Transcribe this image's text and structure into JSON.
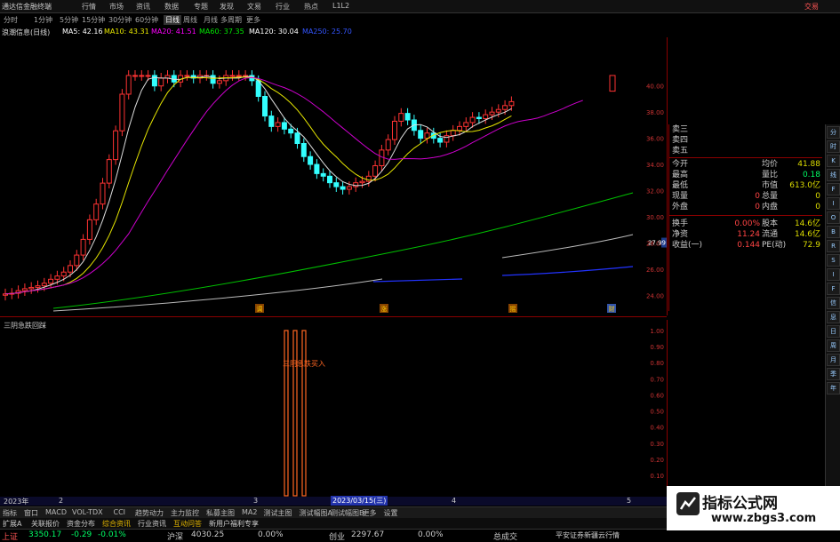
{
  "app": {
    "title": "通达信金融终端",
    "trade": "交易"
  },
  "menu": [
    "行情",
    "市场",
    "资讯",
    "数据",
    "专题",
    "发现",
    "文易",
    "行业",
    "热点",
    "L1L2"
  ],
  "periods": [
    "分时",
    "1分钟",
    "5分钟",
    "15分钟",
    "30分钟",
    "60分钟",
    "日线",
    "周线",
    "月线",
    "多周期",
    "更多"
  ],
  "active_period": "日线",
  "stock_label": "浪潮信息(日线)",
  "ma": [
    {
      "label": "MA5: 42.16",
      "color": "#ffffff"
    },
    {
      "label": "MA10: 43.31",
      "color": "#e6e600"
    },
    {
      "label": "MA20: 41.51",
      "color": "#ff00ff"
    },
    {
      "label": "MA60: 37.35",
      "color": "#00e600"
    },
    {
      "label": "MA120: 30.04",
      "color": "#ffffff"
    },
    {
      "label": "MA250: 25.70",
      "color": "#3355ff"
    }
  ],
  "y_labels": [
    "40.00",
    "38.00",
    "36.00",
    "34.00",
    "32.00",
    "30.00",
    "28.00",
    "26.00",
    "24.00"
  ],
  "price_tag": "27.99",
  "sub_indicator": "三阴急跌回踩",
  "sub_signal_text": "三阴急跌买入",
  "sub_y_labels": [
    "1.00",
    "0.90",
    "0.80",
    "0.70",
    "0.60",
    "0.50",
    "0.40",
    "0.30",
    "0.20",
    "0.10"
  ],
  "markers": [
    "调",
    "涨",
    "摇",
    "财"
  ],
  "quote": {
    "ask_rows": [
      "卖三",
      "卖四",
      "卖五"
    ],
    "rows": [
      {
        "l": "今开",
        "lv": "",
        "r": "均价",
        "rv": "41.88"
      },
      {
        "l": "最高",
        "lv": "",
        "r": "量比",
        "rv": "0.18"
      },
      {
        "l": "最低",
        "lv": "",
        "r": "市值",
        "rv": "613.0亿"
      },
      {
        "l": "现量",
        "lv": "0",
        "r": "总量",
        "rv": "0"
      },
      {
        "l": "外盘",
        "lv": "0",
        "r": "内盘",
        "rv": "0"
      },
      {
        "l": "换手",
        "lv": "0.00%",
        "r": "股本",
        "rv": "14.6亿"
      },
      {
        "l": "净资",
        "lv": "11.24",
        "r": "流通",
        "rv": "14.6亿"
      },
      {
        "l": "收益(一)",
        "lv": "0.144",
        "r": "PE(动)",
        "rv": "72.9"
      }
    ]
  },
  "right_toolbar": [
    "分",
    "时",
    "K",
    "线",
    "F",
    "I",
    "O",
    "B",
    "R",
    "S",
    "I",
    "F",
    "信",
    "息",
    "日",
    "周",
    "月",
    "季",
    "年"
  ],
  "date_axis": {
    "year": "2023年",
    "d1": "2",
    "d2": "3",
    "selected": "2023/03/15(三)",
    "d3": "4",
    "d4": "5"
  },
  "bottom_tabs": [
    "指标",
    "窗口",
    "MACD",
    "VOL-TDX",
    "CCI",
    "趋势动力",
    "主力监控",
    "私募主图",
    "MA2",
    "测试主图",
    "测试幅图A",
    "测试幅图B",
    "更多",
    "设置"
  ],
  "bottom_tabs2": [
    "扩展A",
    "关联报价",
    "资金分布",
    "综合资讯",
    "行业资讯",
    "互动问答",
    "新用户福利专享"
  ],
  "bottom_right": [
    "图文F10",
    "模板"
  ],
  "status": {
    "sh_label": "上证",
    "sh_val": "3350.17",
    "sh_chg": "-0.29",
    "sh_pct": "-0.01%",
    "hs_label": "沪深",
    "hs_val": "4030.25",
    "hs_pct": "0.00%",
    "cy_label": "创业",
    "cy_val": "2297.67",
    "cy_pct": "0.00%",
    "total_label": "总成交",
    "broker": "平安证券新疆云行情"
  },
  "watermark": {
    "title": "指标公式网",
    "url": "www.zbgs3.com"
  }
}
